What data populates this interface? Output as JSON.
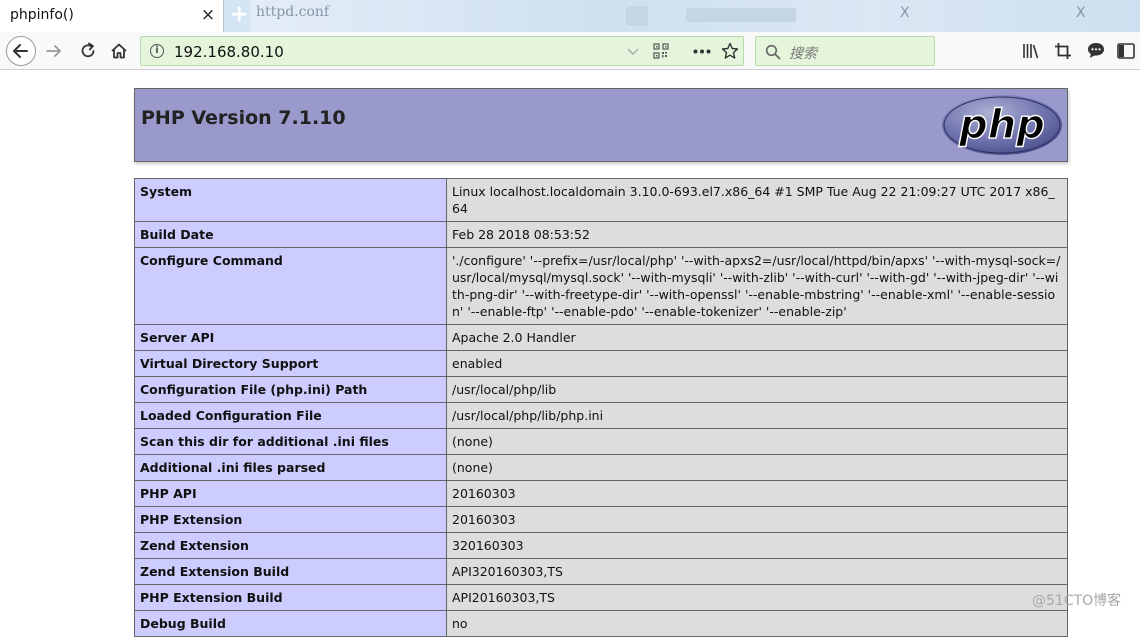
{
  "tab": {
    "title": "phpinfo()",
    "close": "×",
    "new_tab": "+"
  },
  "background_window": {
    "text": "httpd.conf",
    "text2": "X"
  },
  "toolbar": {
    "url": "192.168.80.10",
    "search_placeholder": "搜索"
  },
  "page": {
    "title": "PHP Version 7.1.10",
    "logo_text": "php",
    "rows": [
      {
        "key": "System",
        "value": "Linux localhost.localdomain 3.10.0-693.el7.x86_64 #1 SMP Tue Aug 22 21:09:27 UTC 2017 x86_64"
      },
      {
        "key": "Build Date",
        "value": "Feb 28 2018 08:53:52"
      },
      {
        "key": "Configure Command",
        "value": "'./configure' '--prefix=/usr/local/php' '--with-apxs2=/usr/local/httpd/bin/apxs' '--with-mysql-sock=/usr/local/mysql/mysql.sock' '--with-mysqli' '--with-zlib' '--with-curl' '--with-gd' '--with-jpeg-dir' '--with-png-dir' '--with-freetype-dir' '--with-openssl' '--enable-mbstring' '--enable-xml' '--enable-session' '--enable-ftp' '--enable-pdo' '--enable-tokenizer' '--enable-zip'"
      },
      {
        "key": "Server API",
        "value": "Apache 2.0 Handler"
      },
      {
        "key": "Virtual Directory Support",
        "value": "enabled"
      },
      {
        "key": "Configuration File (php.ini) Path",
        "value": "/usr/local/php/lib"
      },
      {
        "key": "Loaded Configuration File",
        "value": "/usr/local/php/lib/php.ini"
      },
      {
        "key": "Scan this dir for additional .ini files",
        "value": "(none)"
      },
      {
        "key": "Additional .ini files parsed",
        "value": "(none)"
      },
      {
        "key": "PHP API",
        "value": "20160303"
      },
      {
        "key": "PHP Extension",
        "value": "20160303"
      },
      {
        "key": "Zend Extension",
        "value": "320160303"
      },
      {
        "key": "Zend Extension Build",
        "value": "API320160303,TS"
      },
      {
        "key": "PHP Extension Build",
        "value": "API20160303,TS"
      },
      {
        "key": "Debug Build",
        "value": "no"
      }
    ]
  },
  "watermark": "@51CTO博客"
}
